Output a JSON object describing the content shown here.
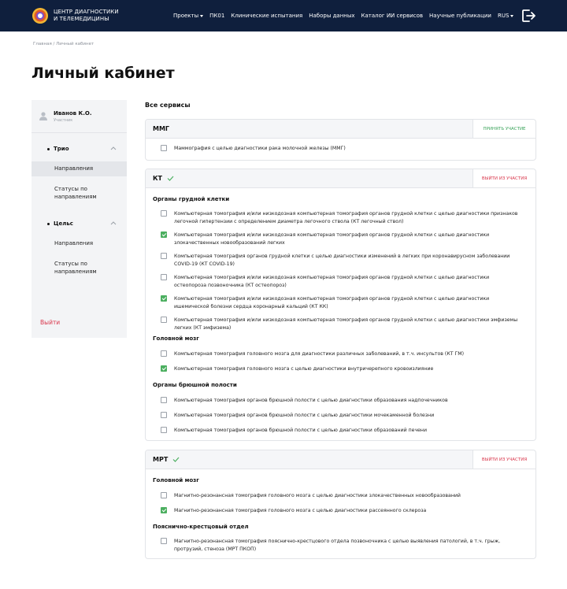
{
  "header": {
    "brand_line1": "ЦЕНТР ДИАГНОСТИКИ",
    "brand_line2": "И ТЕЛЕМЕДИЦИНЫ",
    "nav": [
      {
        "label": "Проекты",
        "dropdown": true
      },
      {
        "label": "ПК01",
        "dropdown": false
      },
      {
        "label": "Клинические испытания",
        "dropdown": false
      },
      {
        "label": "Наборы данных",
        "dropdown": false
      },
      {
        "label": "Каталог ИИ сервисов",
        "dropdown": false
      },
      {
        "label": "Научные публикации",
        "dropdown": false
      },
      {
        "label": "RUS",
        "dropdown": true
      }
    ],
    "logout_icon": "logout-icon"
  },
  "breadcrumb": "Главная / Личный кабинет",
  "page_title": "Личный кабинет",
  "sidebar": {
    "user_name": "Иванов К.О.",
    "user_role": "Участник",
    "groups": [
      {
        "title": "Трио",
        "items": [
          "Направления",
          "Статусы по направлениям"
        ]
      },
      {
        "title": "Цельс",
        "items": [
          "Направления",
          "Статусы по направлениям"
        ]
      }
    ],
    "exit": "Выйти"
  },
  "services_title": "Все сервисы",
  "cards": {
    "mmg": {
      "title": "ММГ",
      "action": "ПРИНЯТЬ УЧАСТИЕ",
      "rows": [
        "Маммография с целью диагностики рака молочной железы (ММГ)"
      ]
    },
    "kt": {
      "title": "КТ",
      "action": "ВЫЙТИ ИЗ УЧАСТИЯ",
      "sections": [
        {
          "title": "Органы грудной клетки",
          "rows": [
            "Компьютерная томография и/или низкодозная компьютерная томография органов грудной клетки с целью диагностики признаков легочной гипертензии с определением диаметра легочного ствола (КТ легочный ствол)",
            "Компьютерная томография и/или низкодозная компьютерная томография органов грудной клетки с целью диагностики злокачественных новообразований легких",
            "Компьютерная томография органов грудной клетки с целью диагностики изменений в легких при коронавирусном заболевании COVID-19 (КТ COVID-19)",
            "Компьютерная томография и/или низкодозная компьютерная томография органов грудной клетки с целью диагностики остеопороза позвоночника (КТ остеопороз)",
            "Компьютерная томография и/или низкодозная компьютерная томография органов грудной клетки с целью диагностики ишемической болезни сердца коронарный кальций (КТ КК)",
            "Компьютерная томография и/или низкодозная компьютерная томография органов грудной клетки с целью диагностики эмфиземы легких (КТ эмфизема)"
          ]
        },
        {
          "title": "Головной мозг",
          "rows": [
            "Компьютерная томография головного мозга для диагностики различных заболеваний, в т.ч. инсультов (КТ ГМ)",
            "Компьютерная томография головного мозга с целью диагностики внутричерепного кровоизлияние"
          ]
        },
        {
          "title": "Органы брюшной полости",
          "rows": [
            "Компьютерная томография органов брюшной полости с целью диагностики образования надпочечников",
            "Компьютерная томография органов брюшной полости с целью диагностики мочекаменной болезни",
            "Компьютерная томография органов брюшной полости с целью диагностики образований печени"
          ]
        }
      ]
    },
    "mrt": {
      "title": "МРТ",
      "action": "ВЫЙТИ ИЗ УЧАСТИЯ",
      "sections": [
        {
          "title": "Головной мозг",
          "rows": [
            "Магнитно-резонансная томография головного мозга с целью диагностики злокачественных новообразований",
            "Магнитно-резонансная томография головного мозга с целью диагностики рассеянного склероза"
          ]
        },
        {
          "title": "Пояснично-крестцовый отдел",
          "rows": [
            "Магнитно-резонансная томография пояснично-крестцового отдела позвоночника с целью выявления патологий, в т.ч. грыж, протрузий, стеноза (МРТ ПКОП)"
          ]
        }
      ]
    }
  },
  "colors": {
    "header_bg": "#0f1f3d",
    "accent_green": "#4caf60",
    "danger": "#d9364b"
  }
}
